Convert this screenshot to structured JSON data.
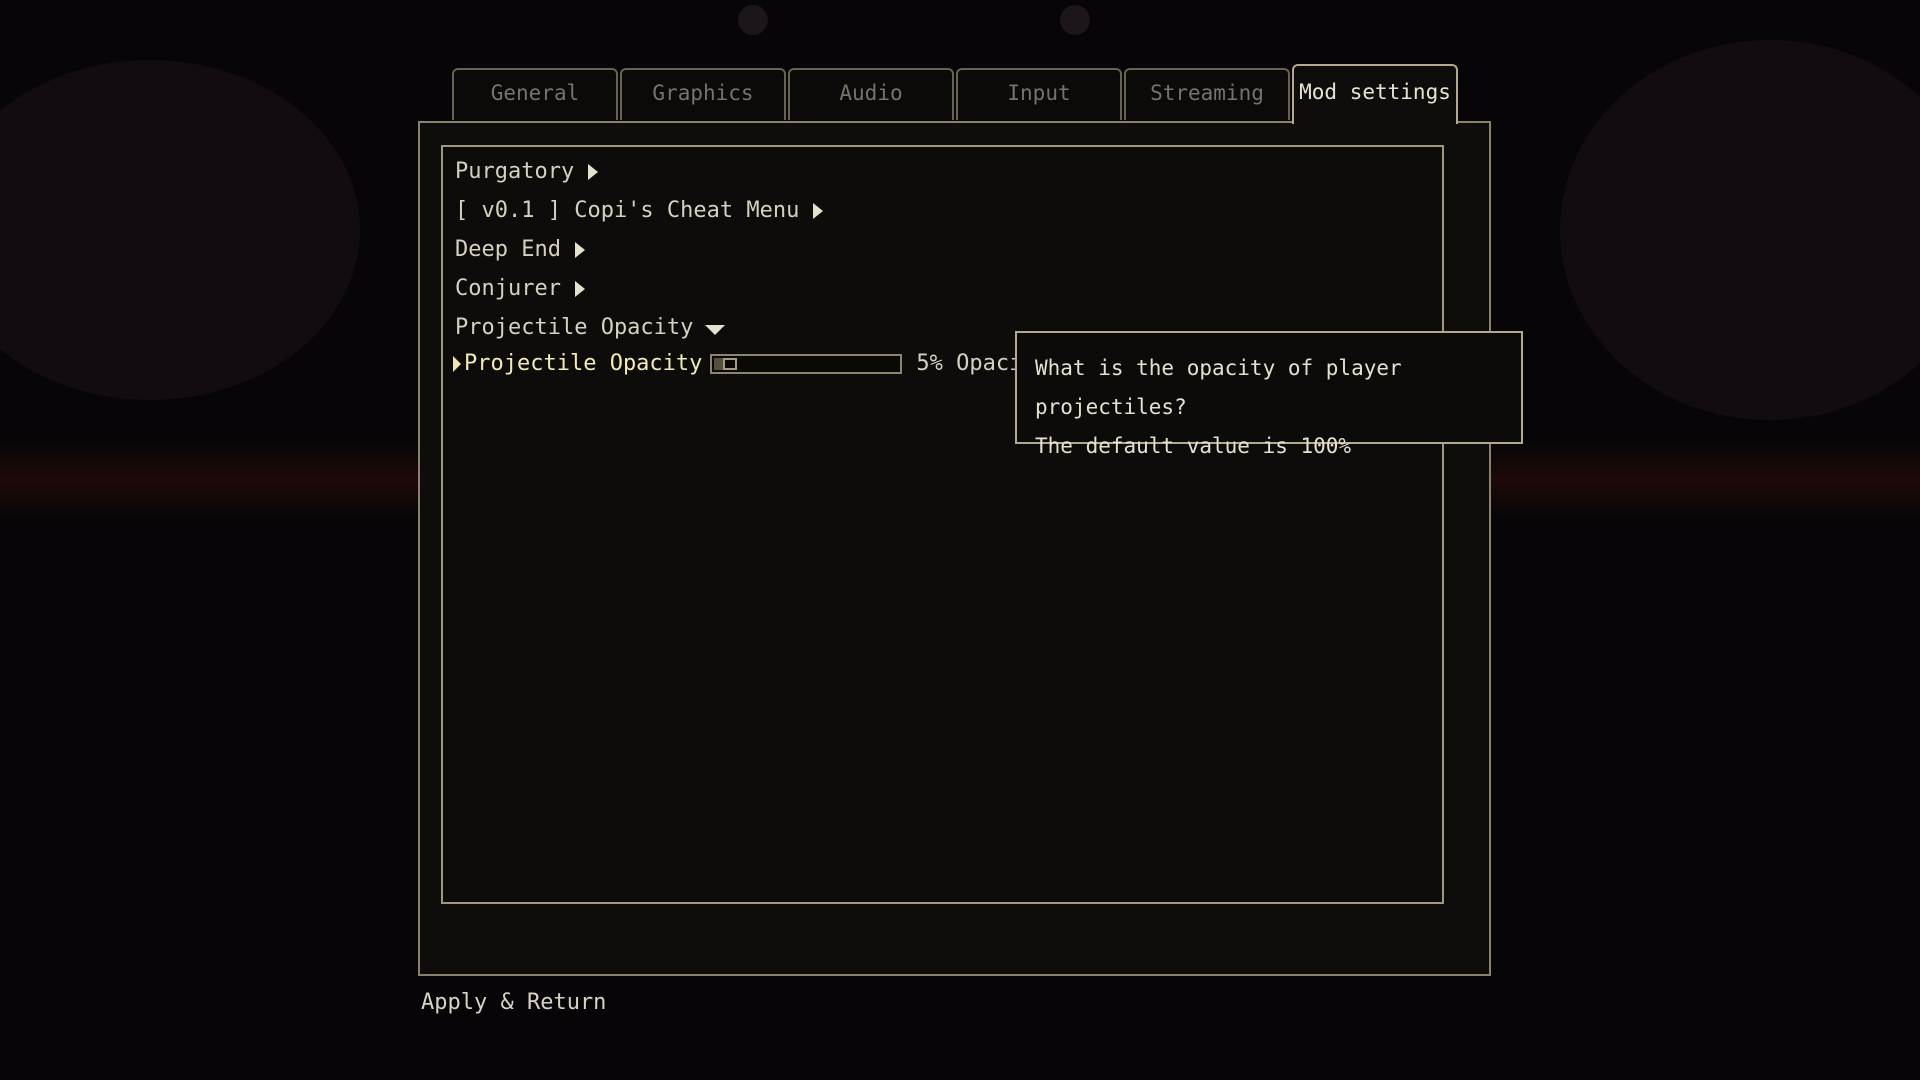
{
  "tabs": [
    {
      "label": "General",
      "active": false
    },
    {
      "label": "Graphics",
      "active": false
    },
    {
      "label": "Audio",
      "active": false
    },
    {
      "label": "Input",
      "active": false
    },
    {
      "label": "Streaming",
      "active": false
    },
    {
      "label": "Mod settings",
      "active": true
    }
  ],
  "mods": [
    {
      "label": "Purgatory",
      "state": "collapsed"
    },
    {
      "label": "[ v0.1 ]  Copi's Cheat Menu",
      "state": "collapsed"
    },
    {
      "label": "Deep End",
      "state": "collapsed"
    },
    {
      "label": "Conjurer",
      "state": "collapsed"
    },
    {
      "label": "Projectile Opacity",
      "state": "expanded"
    }
  ],
  "setting": {
    "label": "Projectile Opacity",
    "value_text": "5% Opacity",
    "value_fraction": 0.05
  },
  "tooltip": {
    "line1": "What is the opacity of player projectiles?",
    "line2": "The default value is 100%"
  },
  "footer": {
    "apply_label": "Apply & Return"
  },
  "colors": {
    "selected_text": "#f2ebb8",
    "frame": "#a0977e"
  }
}
